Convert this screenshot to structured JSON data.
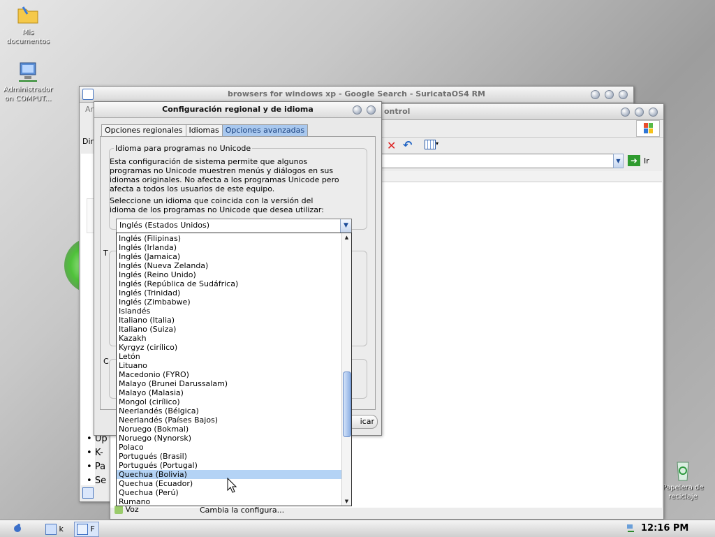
{
  "desktop": {
    "icons": [
      {
        "label": "Mis documentos",
        "icon": "folder-icon"
      },
      {
        "label": "Administrador on COMPUT...",
        "icon": "network-computer-icon"
      },
      {
        "label": "Papelera de reciclaje",
        "icon": "recycle-bin-icon"
      }
    ]
  },
  "browser": {
    "title": "browsers for windows xp - Google Search - SuricataOS4 RM",
    "menu_partial": "Ar",
    "address_partial": "Dire",
    "status_icon": "ie-page-icon",
    "bullets": [
      "Up",
      "K-",
      "Pa",
      "Se"
    ]
  },
  "control_panel": {
    "title_partial": "ontrol",
    "go_label": "Ir",
    "bottom_item_name": "Voz",
    "bottom_item_desc": "Cambia la configura...",
    "partial_button": "icar"
  },
  "dialog": {
    "title": "Configuración regional y de idioma",
    "tabs": [
      "Opciones regionales",
      "Idiomas",
      "Opciones avanzadas"
    ],
    "active_tab": 2,
    "group_label": "Idioma para programas no Unicode",
    "paragraph1": "Esta configuración de sistema permite que algunos programas no Unicode muestren menús y diálogos en sus idiomas originales. No afecta a los programas Unicode pero afecta a todos los usuarios de este equipo.",
    "paragraph2": "Seleccione un idioma que coincida con la versión del idioma de los programas no Unicode que desea utilizar:",
    "combo_value": "Inglés (Estados Unidos)",
    "side_letters": [
      "T",
      "C"
    ]
  },
  "dropdown": {
    "items": [
      "Inglés (Filipinas)",
      "Inglés (Irlanda)",
      "Inglés (Jamaica)",
      "Inglés (Nueva Zelanda)",
      "Inglés (Reino Unido)",
      "Inglés (República de Sudáfrica)",
      "Inglés (Trinidad)",
      "Inglés (Zimbabwe)",
      "Islandés",
      "Italiano (Italia)",
      "Italiano (Suiza)",
      "Kazakh",
      "Kyrgyz (cirílico)",
      "Letón",
      "Lituano",
      "Macedonio (FYRO)",
      "Malayo (Brunei Darussalam)",
      "Malayo (Malasia)",
      "Mongol (cirílico)",
      "Neerlandés (Bélgica)",
      "Neerlandés (Países Bajos)",
      "Noruego (Bokmal)",
      "Noruego (Nynorsk)",
      "Polaco",
      "Portugués (Brasil)",
      "Portugués (Portugal)",
      "Quechua (Bolivia)",
      "Quechua (Ecuador)",
      "Quechua (Perú)",
      "Rumano"
    ],
    "selected_index": 26
  },
  "taskbar": {
    "time": "12:16 PM",
    "items": [
      {
        "label": "k"
      },
      {
        "label": "F"
      }
    ]
  },
  "colors": {
    "selection": "#b4d3f5",
    "active_tab": "#a9c8ee",
    "title_text": "#6e6e6e"
  }
}
